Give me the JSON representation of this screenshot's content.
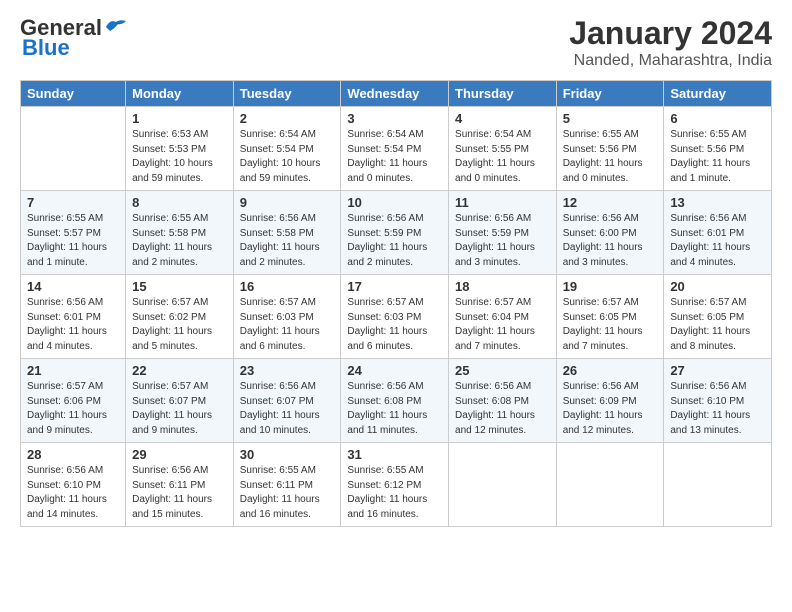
{
  "header": {
    "logo_line1": "General",
    "logo_line2": "Blue",
    "month_year": "January 2024",
    "location": "Nanded, Maharashtra, India"
  },
  "days_of_week": [
    "Sunday",
    "Monday",
    "Tuesday",
    "Wednesday",
    "Thursday",
    "Friday",
    "Saturday"
  ],
  "weeks": [
    [
      {
        "num": "",
        "info": ""
      },
      {
        "num": "1",
        "info": "Sunrise: 6:53 AM\nSunset: 5:53 PM\nDaylight: 10 hours\nand 59 minutes."
      },
      {
        "num": "2",
        "info": "Sunrise: 6:54 AM\nSunset: 5:54 PM\nDaylight: 10 hours\nand 59 minutes."
      },
      {
        "num": "3",
        "info": "Sunrise: 6:54 AM\nSunset: 5:54 PM\nDaylight: 11 hours\nand 0 minutes."
      },
      {
        "num": "4",
        "info": "Sunrise: 6:54 AM\nSunset: 5:55 PM\nDaylight: 11 hours\nand 0 minutes."
      },
      {
        "num": "5",
        "info": "Sunrise: 6:55 AM\nSunset: 5:56 PM\nDaylight: 11 hours\nand 0 minutes."
      },
      {
        "num": "6",
        "info": "Sunrise: 6:55 AM\nSunset: 5:56 PM\nDaylight: 11 hours\nand 1 minute."
      }
    ],
    [
      {
        "num": "7",
        "info": "Sunrise: 6:55 AM\nSunset: 5:57 PM\nDaylight: 11 hours\nand 1 minute."
      },
      {
        "num": "8",
        "info": "Sunrise: 6:55 AM\nSunset: 5:58 PM\nDaylight: 11 hours\nand 2 minutes."
      },
      {
        "num": "9",
        "info": "Sunrise: 6:56 AM\nSunset: 5:58 PM\nDaylight: 11 hours\nand 2 minutes."
      },
      {
        "num": "10",
        "info": "Sunrise: 6:56 AM\nSunset: 5:59 PM\nDaylight: 11 hours\nand 2 minutes."
      },
      {
        "num": "11",
        "info": "Sunrise: 6:56 AM\nSunset: 5:59 PM\nDaylight: 11 hours\nand 3 minutes."
      },
      {
        "num": "12",
        "info": "Sunrise: 6:56 AM\nSunset: 6:00 PM\nDaylight: 11 hours\nand 3 minutes."
      },
      {
        "num": "13",
        "info": "Sunrise: 6:56 AM\nSunset: 6:01 PM\nDaylight: 11 hours\nand 4 minutes."
      }
    ],
    [
      {
        "num": "14",
        "info": "Sunrise: 6:56 AM\nSunset: 6:01 PM\nDaylight: 11 hours\nand 4 minutes."
      },
      {
        "num": "15",
        "info": "Sunrise: 6:57 AM\nSunset: 6:02 PM\nDaylight: 11 hours\nand 5 minutes."
      },
      {
        "num": "16",
        "info": "Sunrise: 6:57 AM\nSunset: 6:03 PM\nDaylight: 11 hours\nand 6 minutes."
      },
      {
        "num": "17",
        "info": "Sunrise: 6:57 AM\nSunset: 6:03 PM\nDaylight: 11 hours\nand 6 minutes."
      },
      {
        "num": "18",
        "info": "Sunrise: 6:57 AM\nSunset: 6:04 PM\nDaylight: 11 hours\nand 7 minutes."
      },
      {
        "num": "19",
        "info": "Sunrise: 6:57 AM\nSunset: 6:05 PM\nDaylight: 11 hours\nand 7 minutes."
      },
      {
        "num": "20",
        "info": "Sunrise: 6:57 AM\nSunset: 6:05 PM\nDaylight: 11 hours\nand 8 minutes."
      }
    ],
    [
      {
        "num": "21",
        "info": "Sunrise: 6:57 AM\nSunset: 6:06 PM\nDaylight: 11 hours\nand 9 minutes."
      },
      {
        "num": "22",
        "info": "Sunrise: 6:57 AM\nSunset: 6:07 PM\nDaylight: 11 hours\nand 9 minutes."
      },
      {
        "num": "23",
        "info": "Sunrise: 6:56 AM\nSunset: 6:07 PM\nDaylight: 11 hours\nand 10 minutes."
      },
      {
        "num": "24",
        "info": "Sunrise: 6:56 AM\nSunset: 6:08 PM\nDaylight: 11 hours\nand 11 minutes."
      },
      {
        "num": "25",
        "info": "Sunrise: 6:56 AM\nSunset: 6:08 PM\nDaylight: 11 hours\nand 12 minutes."
      },
      {
        "num": "26",
        "info": "Sunrise: 6:56 AM\nSunset: 6:09 PM\nDaylight: 11 hours\nand 12 minutes."
      },
      {
        "num": "27",
        "info": "Sunrise: 6:56 AM\nSunset: 6:10 PM\nDaylight: 11 hours\nand 13 minutes."
      }
    ],
    [
      {
        "num": "28",
        "info": "Sunrise: 6:56 AM\nSunset: 6:10 PM\nDaylight: 11 hours\nand 14 minutes."
      },
      {
        "num": "29",
        "info": "Sunrise: 6:56 AM\nSunset: 6:11 PM\nDaylight: 11 hours\nand 15 minutes."
      },
      {
        "num": "30",
        "info": "Sunrise: 6:55 AM\nSunset: 6:11 PM\nDaylight: 11 hours\nand 16 minutes."
      },
      {
        "num": "31",
        "info": "Sunrise: 6:55 AM\nSunset: 6:12 PM\nDaylight: 11 hours\nand 16 minutes."
      },
      {
        "num": "",
        "info": ""
      },
      {
        "num": "",
        "info": ""
      },
      {
        "num": "",
        "info": ""
      }
    ]
  ]
}
